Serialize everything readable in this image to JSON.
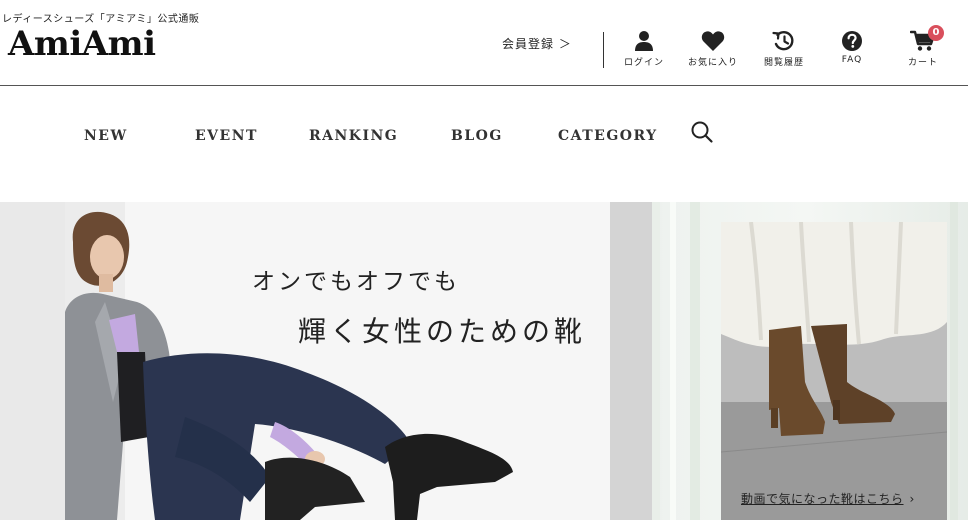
{
  "header": {
    "tagline": "レディースシューズ「アミアミ」公式通販",
    "logo": "AmiAmi",
    "register_label": "会員登録 ＞",
    "icons": [
      {
        "id": "login",
        "label": "ログイン",
        "icon": "user-icon"
      },
      {
        "id": "favorites",
        "label": "お気に入り",
        "icon": "heart-icon"
      },
      {
        "id": "history",
        "label": "閲覧履歴",
        "icon": "history-icon"
      },
      {
        "id": "faq",
        "label": "FAQ",
        "icon": "question-icon"
      },
      {
        "id": "cart",
        "label": "カート",
        "icon": "cart-icon",
        "badge": "0"
      }
    ]
  },
  "nav": {
    "items": [
      "NEW",
      "EVENT",
      "RANKING",
      "BLOG",
      "CATEGORY"
    ],
    "search_icon": "search-icon"
  },
  "hero": {
    "copy_line1": "オンでもオフでも",
    "copy_line2": "輝く女性のための靴"
  },
  "side_banner": {
    "link_text": "動画で気になった靴はこちら",
    "chevron": "›"
  },
  "colors": {
    "badge": "#d94f5c",
    "text": "#222222",
    "hero_bg": "#e9e9e9"
  }
}
